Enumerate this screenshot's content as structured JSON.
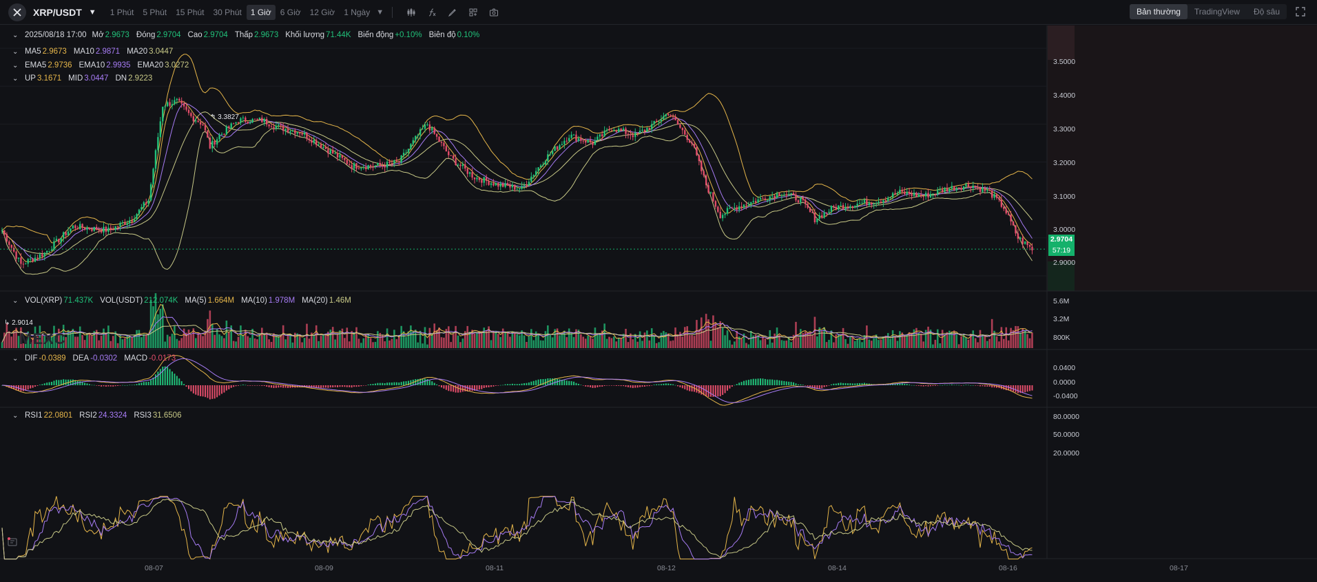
{
  "toolbar": {
    "symbol": "XRP/USDT",
    "intervals": [
      "1 Phút",
      "5 Phút",
      "15 Phút",
      "30 Phút",
      "1 Giờ",
      "6 Giờ",
      "12 Giờ",
      "1 Ngày"
    ],
    "active_interval": "1 Giờ",
    "views": [
      "Bản thường",
      "TradingView",
      "Độ sâu"
    ],
    "active_view": "Bản thường",
    "tool_icons": [
      "indicators-icon",
      "function-icon",
      "draw-icon",
      "layout-icon",
      "camera-icon"
    ]
  },
  "ohlc": {
    "date": "2025/08/18 17:00",
    "open_label": "Mở",
    "open": "2.9673",
    "close_label": "Đóng",
    "close": "2.9704",
    "high_label": "Cao",
    "high": "2.9704",
    "low_label": "Thấp",
    "low": "2.9673",
    "volume_label": "Khối lượng",
    "volume": "71.44K",
    "change_label": "Biến động",
    "change": "+0.10%",
    "amplitude_label": "Biên độ",
    "amplitude": "0.10%"
  },
  "ma": {
    "ma5_label": "MA5",
    "ma5": "2.9673",
    "ma10_label": "MA10",
    "ma10": "2.9871",
    "ma20_label": "MA20",
    "ma20": "3.0447"
  },
  "ema": {
    "ema5_label": "EMA5",
    "ema5": "2.9736",
    "ema10_label": "EMA10",
    "ema10": "2.9935",
    "ema20_label": "EMA20",
    "ema20": "3.0272"
  },
  "boll": {
    "up_label": "UP",
    "up": "3.1671",
    "mid_label": "MID",
    "mid": "3.0447",
    "dn_label": "DN",
    "dn": "2.9223"
  },
  "price_axis": [
    "3.5000",
    "3.4000",
    "3.3000",
    "3.2000",
    "3.1000",
    "3.0000",
    "2.9000"
  ],
  "last_price": "2.9704",
  "countdown": "57:19",
  "high_marker": "3.3827",
  "low_marker": "2.9014",
  "watermark": "MEXC",
  "volume": {
    "vol_label": "VOL(XRP)",
    "vol": "71.437K",
    "volusdt_label": "VOL(USDT)",
    "volusdt": "212.074K",
    "ma5_label": "MA(5)",
    "ma5": "1.664M",
    "ma10_label": "MA(10)",
    "ma10": "1.978M",
    "ma20_label": "MA(20)",
    "ma20": "1.46M",
    "axis": [
      "5.6M",
      "3.2M",
      "800K"
    ]
  },
  "macd": {
    "dif_label": "DIF",
    "dif": "-0.0389",
    "dea_label": "DEA",
    "dea": "-0.0302",
    "macd_label": "MACD",
    "macd": "-0.0173",
    "axis": [
      "0.0400",
      "0.0000",
      "-0.0400"
    ]
  },
  "rsi": {
    "rsi1_label": "RSI1",
    "rsi1": "22.0801",
    "rsi2_label": "RSI2",
    "rsi2": "24.3324",
    "rsi3_label": "RSI3",
    "rsi3": "31.6506",
    "axis": [
      "80.0000",
      "50.0000",
      "20.0000"
    ]
  },
  "dates": [
    "08-07",
    "08-09",
    "08-11",
    "08-12",
    "08-14",
    "08-16",
    "08-17"
  ],
  "colors": {
    "up": "#21c17a",
    "down": "#e24d6a",
    "ma5": "#e6b64a",
    "ma10": "#a77cf5",
    "ma20": "#c8c987",
    "background": "#111216"
  },
  "chart_data": {
    "type": "candlestick",
    "y_range": [
      2.86,
      3.56
    ],
    "keypoints": [
      [
        0,
        3.02
      ],
      [
        8,
        2.93
      ],
      [
        18,
        2.96
      ],
      [
        30,
        3.03
      ],
      [
        45,
        3.02
      ],
      [
        55,
        3.05
      ],
      [
        62,
        3.1
      ],
      [
        68,
        3.35
      ],
      [
        74,
        3.36
      ],
      [
        80,
        3.32
      ],
      [
        85,
        3.3
      ],
      [
        88,
        3.24
      ],
      [
        92,
        3.27
      ],
      [
        100,
        3.31
      ],
      [
        110,
        3.31
      ],
      [
        118,
        3.29
      ],
      [
        126,
        3.28
      ],
      [
        136,
        3.24
      ],
      [
        148,
        3.19
      ],
      [
        160,
        3.19
      ],
      [
        168,
        3.2
      ],
      [
        176,
        3.27
      ],
      [
        180,
        3.3
      ],
      [
        190,
        3.21
      ],
      [
        200,
        3.16
      ],
      [
        210,
        3.14
      ],
      [
        220,
        3.13
      ],
      [
        230,
        3.21
      ],
      [
        240,
        3.27
      ],
      [
        250,
        3.25
      ],
      [
        258,
        3.29
      ],
      [
        268,
        3.27
      ],
      [
        276,
        3.3
      ],
      [
        282,
        3.33
      ],
      [
        292,
        3.25
      ],
      [
        298,
        3.14
      ],
      [
        304,
        3.06
      ],
      [
        310,
        3.08
      ],
      [
        320,
        3.1
      ],
      [
        330,
        3.12
      ],
      [
        338,
        3.1
      ],
      [
        344,
        3.05
      ],
      [
        352,
        3.08
      ],
      [
        362,
        3.09
      ],
      [
        372,
        3.1
      ],
      [
        380,
        3.12
      ],
      [
        390,
        3.11
      ],
      [
        400,
        3.13
      ],
      [
        410,
        3.14
      ],
      [
        418,
        3.12
      ],
      [
        424,
        3.08
      ],
      [
        430,
        3.0
      ],
      [
        436,
        2.97
      ]
    ],
    "volume_range": [
      0,
      7.2
    ],
    "macd_range": [
      -0.06,
      0.1
    ],
    "rsi_range": [
      5,
      95
    ]
  }
}
